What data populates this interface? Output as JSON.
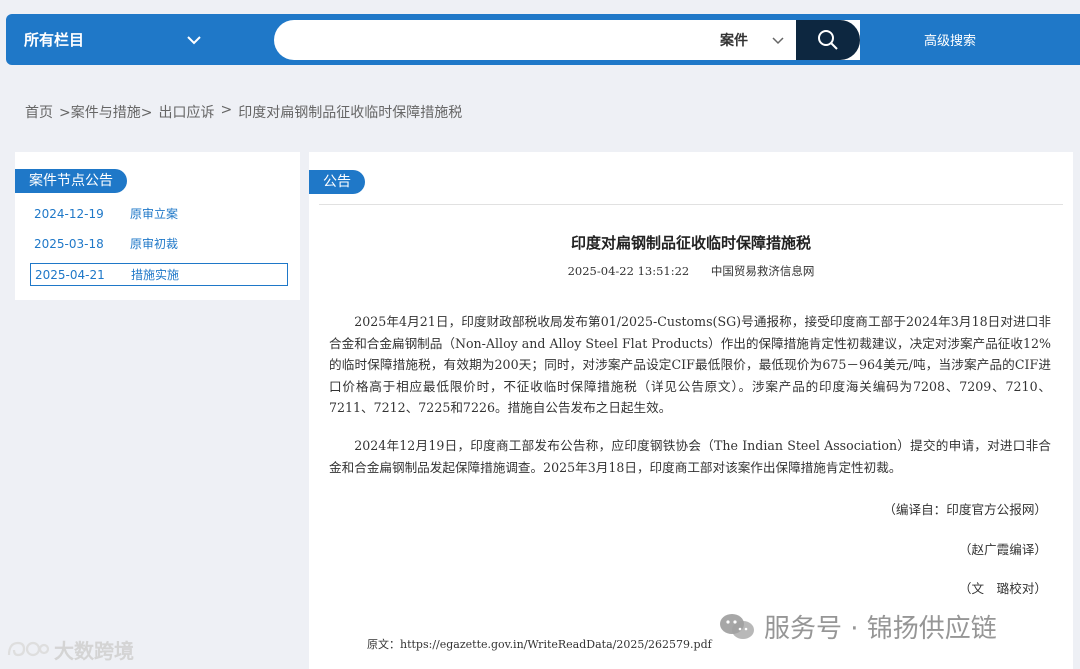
{
  "header": {
    "category": "所有栏目",
    "search_placeholder": "",
    "search_type": "案件",
    "advanced_search": "高级搜索"
  },
  "breadcrumb": [
    "首页",
    ">案件与措施>",
    "出口应诉",
    ">",
    "印度对扁钢制品征收临时保障措施税"
  ],
  "sidebar": {
    "title": "案件节点公告",
    "items": [
      {
        "date": "2024-12-19",
        "label": "原审立案"
      },
      {
        "date": "2025-03-18",
        "label": "原审初裁"
      },
      {
        "date": "2025-04-21",
        "label": "措施实施"
      }
    ]
  },
  "article": {
    "section": "公告",
    "title": "印度对扁钢制品征收临时保障措施税",
    "datetime": "2025-04-22 13:51:22",
    "source_org": "中国贸易救济信息网",
    "paragraphs": [
      "2025年4月21日，印度财政部税收局发布第01/2025-Customs(SG)号通报称，接受印度商工部于2024年3月18日对进口非合金和合金扁钢制品（Non-Alloy and Alloy Steel Flat Products）作出的保障措施肯定性初裁建议，决定对涉案产品征收12%的临时保障措施税，有效期为200天；同时，对涉案产品设定CIF最低限价，最低现价为675－964美元/吨，当涉案产品的CIF进口价格高于相应最低限价时，不征收临时保障措施税（详见公告原文）。涉案产品的印度海关编码为7208、7209、7210、7211、7212、7225和7226。措施自公告发布之日起生效。",
      "2024年12月19日，印度商工部发布公告称，应印度钢铁协会（The Indian Steel Association）提交的申请，对进口非合金和合金扁钢制品发起保障措施调查。2025年3月18日，印度商工部对该案作出保障措施肯定性初裁。"
    ],
    "compiled_from": "（编译自：印度官方公报网）",
    "editor": "（赵广霞编译）",
    "proofreader": "（文　璐校对）",
    "source_link": "原文：https://egazette.gov.in/WriteReadData/2025/262579.pdf"
  },
  "watermarks": {
    "right": "服务号 · 锦扬供应链",
    "left": "大数跨境"
  }
}
